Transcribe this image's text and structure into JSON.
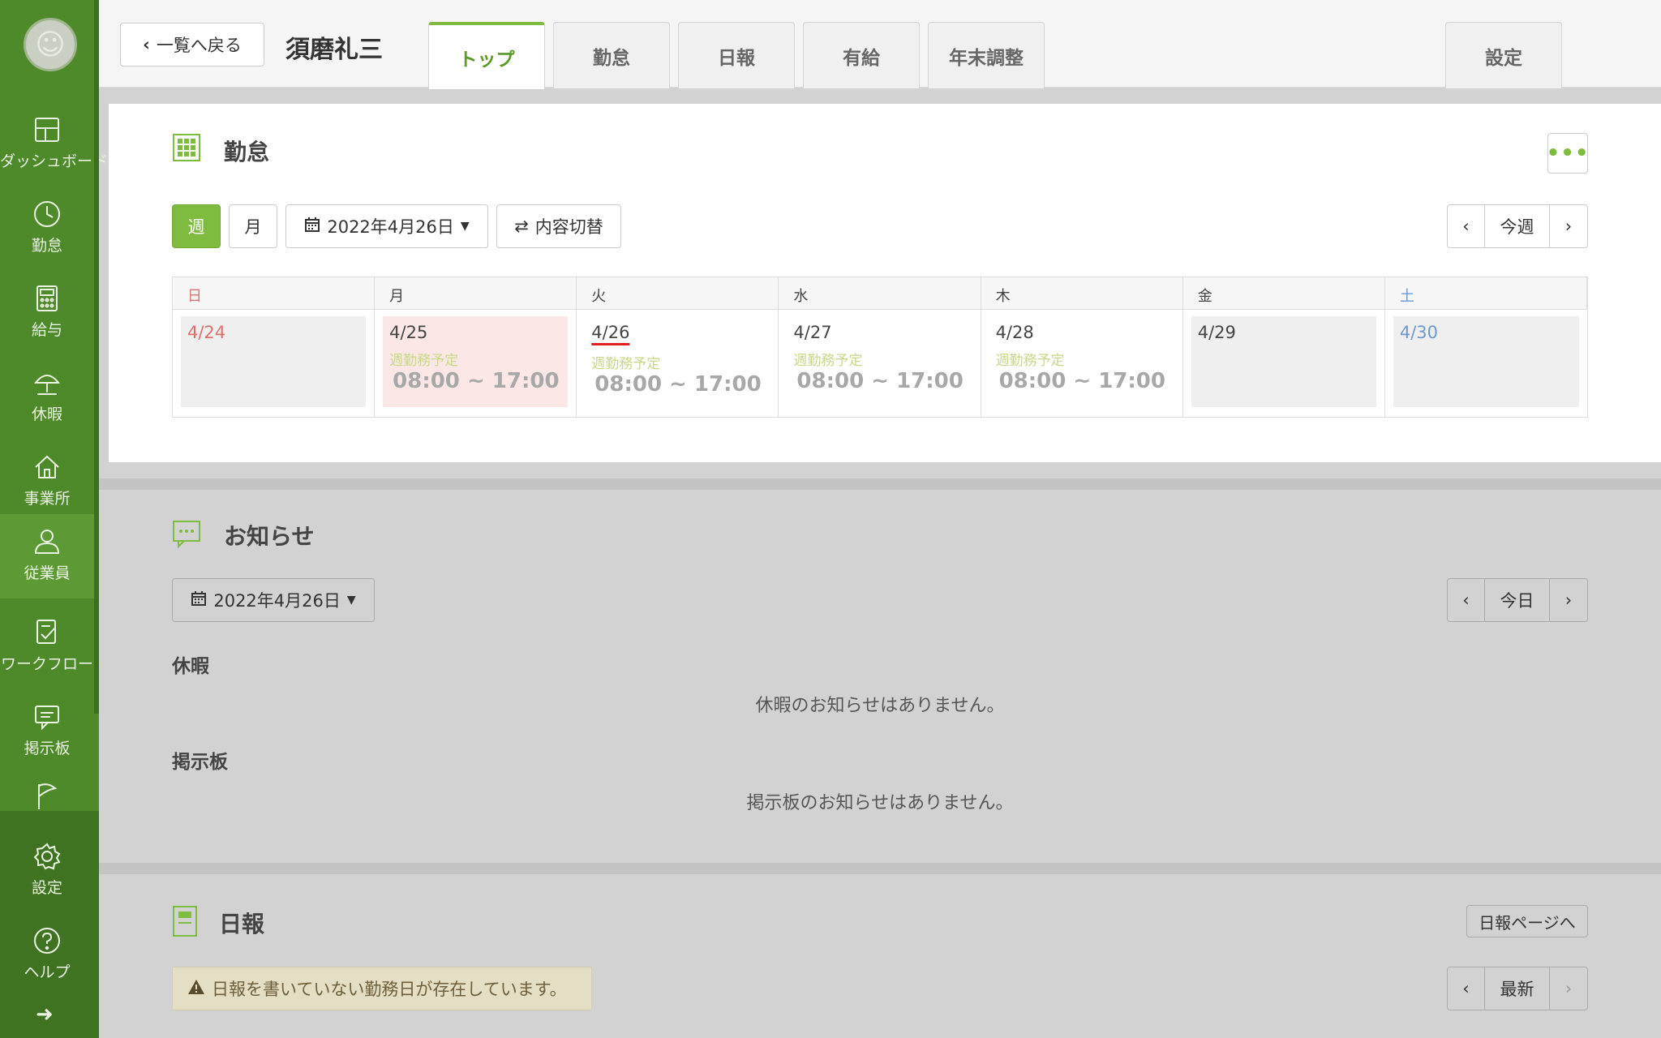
{
  "sidebar": {
    "items": [
      {
        "label": "ダッシュボード",
        "icon": "dashboard-icon"
      },
      {
        "label": "勤怠",
        "icon": "clock-icon"
      },
      {
        "label": "給与",
        "icon": "calculator-icon"
      },
      {
        "label": "休暇",
        "icon": "umbrella-icon"
      },
      {
        "label": "事業所",
        "icon": "home-icon"
      },
      {
        "label": "従業員",
        "icon": "person-icon"
      },
      {
        "label": "ワークフロー",
        "icon": "checklist-icon"
      },
      {
        "label": "掲示板",
        "icon": "message-icon"
      },
      {
        "label": "",
        "icon": "flag-icon"
      }
    ],
    "bottom_items": [
      {
        "label": "設定",
        "icon": "gear-icon"
      },
      {
        "label": "ヘルプ",
        "icon": "help-icon"
      }
    ],
    "accent": "#4e8a2a"
  },
  "header": {
    "back_label": "一覧へ戻る",
    "employee_name": "須磨礼三",
    "tabs": [
      {
        "label": "トップ",
        "active": true
      },
      {
        "label": "勤怠"
      },
      {
        "label": "日報"
      },
      {
        "label": "有給"
      },
      {
        "label": "年末調整"
      }
    ],
    "settings_tab": "設定"
  },
  "attendance": {
    "title": "勤怠",
    "view_week": "週",
    "view_month": "月",
    "date_picker": "2022年4月26日",
    "toggle_label": "内容切替",
    "prev": "‹",
    "current": "今週",
    "next": "›",
    "days": [
      {
        "weekday": "日",
        "date": "4/24",
        "style": "gray",
        "color": "red"
      },
      {
        "weekday": "月",
        "date": "4/25",
        "style": "pink",
        "sub": "週勤務予定",
        "time": "08:00 ~ 17:00"
      },
      {
        "weekday": "火",
        "date": "4/26",
        "style": "white",
        "today": true,
        "sub": "週勤務予定",
        "time": "08:00 ~ 17:00"
      },
      {
        "weekday": "水",
        "date": "4/27",
        "style": "white",
        "sub": "週勤務予定",
        "time": "08:00 ~ 17:00"
      },
      {
        "weekday": "木",
        "date": "4/28",
        "style": "white",
        "sub": "週勤務予定",
        "time": "08:00 ~ 17:00"
      },
      {
        "weekday": "金",
        "date": "4/29",
        "style": "gray"
      },
      {
        "weekday": "土",
        "date": "4/30",
        "style": "gray",
        "color": "blue"
      }
    ]
  },
  "notices": {
    "title": "お知らせ",
    "date_picker": "2022年4月26日",
    "prev": "‹",
    "current": "今日",
    "next": "›",
    "leave_heading": "休暇",
    "leave_empty": "休暇のお知らせはありません。",
    "board_heading": "掲示板",
    "board_empty": "掲示板のお知らせはありません。"
  },
  "daily_report": {
    "title": "日報",
    "page_link": "日報ページへ",
    "warning": "日報を書いていない勤務日が存在しています。",
    "prev": "‹",
    "current": "最新",
    "next": "›"
  }
}
